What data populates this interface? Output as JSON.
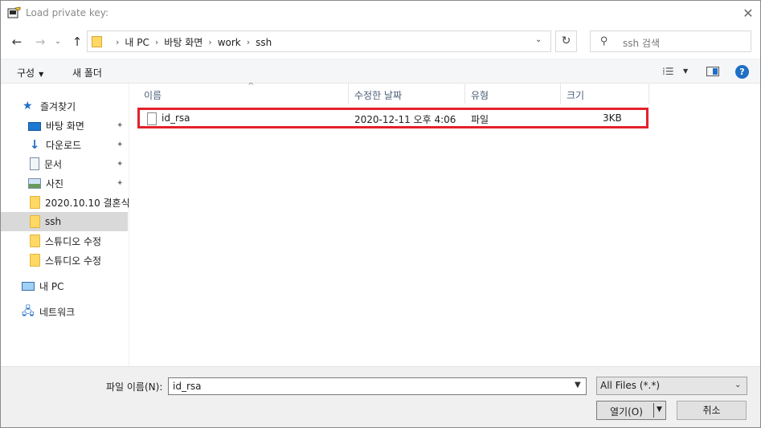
{
  "window": {
    "title": "Load private key:",
    "close": "✕"
  },
  "nav": {
    "back": "←",
    "forward": "→",
    "recent": "⌄",
    "up": "↑",
    "refresh": "↻"
  },
  "address": {
    "crumbs": [
      "내 PC",
      "바탕 화면",
      "work",
      "ssh"
    ],
    "separator": "›",
    "dropdown": "⌄"
  },
  "search": {
    "placeholder": "ssh 검색",
    "icon": "search-icon"
  },
  "toolbar": {
    "organize": "구성",
    "organize_caret": "▼",
    "new_folder": "새 폴더",
    "view_icon": "⁞☰",
    "view_caret": "▼",
    "help": "?"
  },
  "sidebar": {
    "items": [
      {
        "label": "즐겨찾기",
        "icon": "star-icon",
        "pinned": false
      },
      {
        "label": "바탕 화면",
        "icon": "desktop-icon",
        "pinned": true
      },
      {
        "label": "다운로드",
        "icon": "download-icon",
        "pinned": true
      },
      {
        "label": "문서",
        "icon": "document-icon",
        "pinned": true
      },
      {
        "label": "사진",
        "icon": "picture-icon",
        "pinned": true
      },
      {
        "label": "2020.10.10 결혼식",
        "icon": "folder-icon",
        "pinned": false
      },
      {
        "label": "ssh",
        "icon": "folder-icon",
        "pinned": false,
        "selected": true
      },
      {
        "label": "스튜디오 수정",
        "icon": "folder-icon",
        "pinned": false
      },
      {
        "label": "스튜디오 수정",
        "icon": "folder-icon",
        "pinned": false
      },
      {
        "label": "내 PC",
        "icon": "pc-icon",
        "pinned": false
      },
      {
        "label": "네트워크",
        "icon": "network-icon",
        "pinned": false
      }
    ],
    "pin_glyph": "📌"
  },
  "columns": {
    "name": "이름",
    "modified": "수정한 날짜",
    "type": "유형",
    "size": "크기",
    "sort_caret": "^"
  },
  "files": [
    {
      "name": "id_rsa",
      "modified": "2020-12-11 오후 4:06",
      "type": "파일",
      "size": "3KB"
    }
  ],
  "bottom": {
    "filename_label": "파일 이름(N):",
    "filename_value": "id_rsa",
    "filetype": "All Files (*.*)",
    "open": "열기(O)",
    "cancel": "취소",
    "caret": "▼"
  },
  "colors": {
    "highlight": "#e3212b",
    "accent": "#1f6fc5",
    "selected_row": "#d9d9d9"
  }
}
